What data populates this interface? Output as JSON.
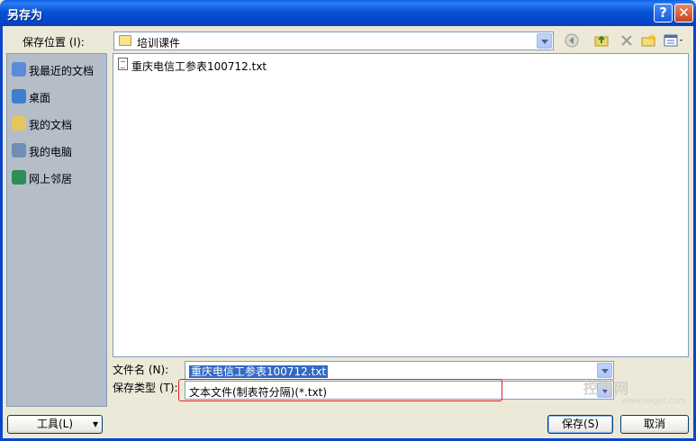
{
  "window": {
    "title": "另存为",
    "help_label": "?",
    "close_label": "✕"
  },
  "save_in": {
    "label": "保存位置",
    "accelerator": "(I):",
    "value": "培训课件"
  },
  "toolbar": {
    "icons": [
      "back-icon",
      "up-folder-icon",
      "delete-icon",
      "new-folder-icon",
      "view-menu-icon"
    ]
  },
  "places": [
    {
      "label": "我最近的文档",
      "icon": "recent-documents-icon",
      "color": "#5b8bd6"
    },
    {
      "label": "桌面",
      "icon": "desktop-icon",
      "color": "#3c7fd1"
    },
    {
      "label": "我的文档",
      "icon": "my-documents-icon",
      "color": "#e6c65c"
    },
    {
      "label": "我的电脑",
      "icon": "my-computer-icon",
      "color": "#6d8fb7"
    },
    {
      "label": "网上邻居",
      "icon": "network-icon",
      "color": "#2f8d56"
    }
  ],
  "files": [
    {
      "name": "重庆电信工参表100712.txt"
    }
  ],
  "filename": {
    "label": "文件名",
    "accelerator": "(N):",
    "value": "重庆电信工参表100712.txt"
  },
  "filetype": {
    "label": "保存类型",
    "accelerator": "(T):",
    "value": "文本文件(制表符分隔)(*.txt)"
  },
  "buttons": {
    "tools": "工具",
    "tools_accel": "(L)",
    "tools_arrow": "▾",
    "save": "保存",
    "save_accel": "(S)",
    "cancel": "取消"
  },
  "watermark": {
    "text": "控件网",
    "sub": "www.evget.com"
  },
  "colors": {
    "titlebar": "#0752d6",
    "highlight": "#316ac5",
    "annotation": "#e0202a"
  }
}
